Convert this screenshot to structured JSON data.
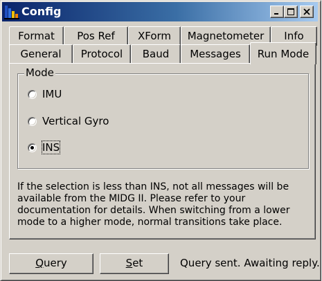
{
  "window": {
    "title": "Config",
    "icon": "app-icon",
    "controls": {
      "minimize": "minimize-icon",
      "maximize": "maximize-icon",
      "close": "close-icon"
    }
  },
  "tabs": {
    "row_back": [
      "Format",
      "Pos Ref",
      "XForm",
      "Magnetometer",
      "Info"
    ],
    "row_front": [
      "General",
      "Protocol",
      "Baud",
      "Messages",
      "Run Mode"
    ],
    "active": "Run Mode"
  },
  "mode_group": {
    "label": "Mode",
    "options": [
      "IMU",
      "Vertical Gyro",
      "INS"
    ],
    "selected": "INS"
  },
  "info_text": "If the selection is less than INS, not all messages will be available from the MIDG II.  Please refer to your documentation for details.  When switching from a lower mode to a higher mode, normal transitions take place.",
  "buttons": {
    "query": {
      "label": "Query",
      "accel": "Q",
      "rest": "uery"
    },
    "set": {
      "label": "Set",
      "accel": "S",
      "rest": "et"
    }
  },
  "status": "Query sent. Awaiting reply."
}
